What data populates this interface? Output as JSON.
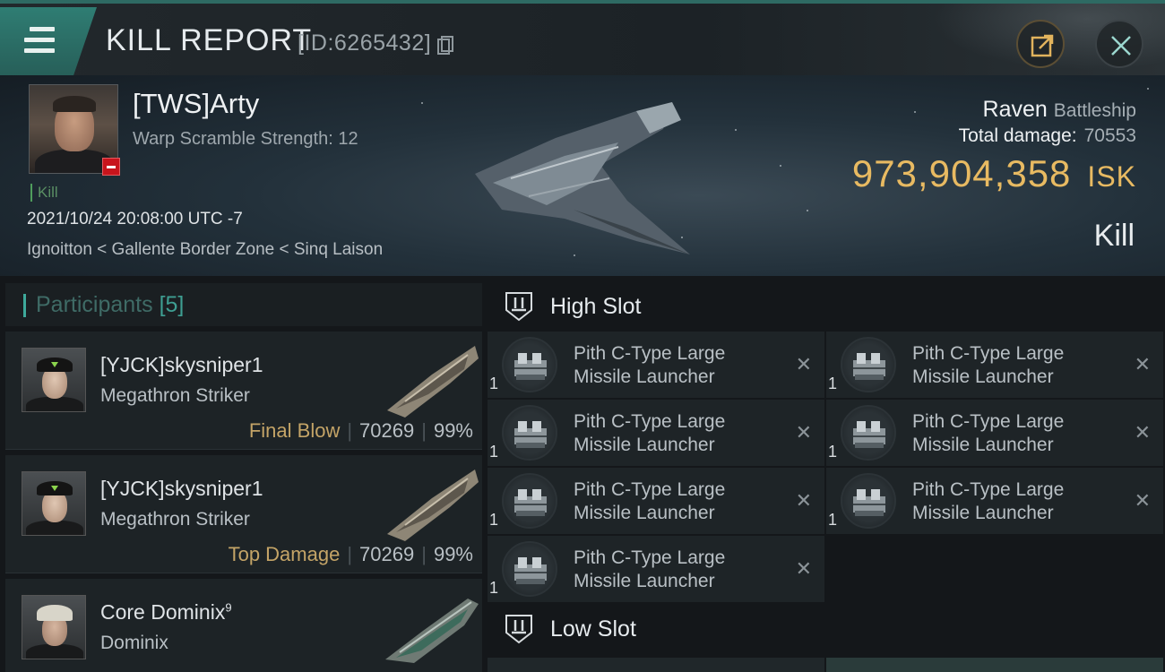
{
  "header": {
    "title": "KILL REPORT",
    "report_id": "[ID:6265432]"
  },
  "victim": {
    "name": "[TWS]Arty",
    "warp_scramble": "Warp Scramble Strength: 12",
    "kill_tag": "Kill",
    "datetime": "2021/10/24 20:08:00 UTC -7",
    "location": "Ignoitton < Gallente Border Zone < Sinq Laison",
    "ship_name": "Raven",
    "ship_class": "Battleship",
    "total_damage_label": "Total damage:",
    "total_damage": "70553",
    "isk_value": "973,904,358",
    "isk_unit": "ISK",
    "result": "Kill"
  },
  "participants": {
    "label": "Participants",
    "count": "[5]",
    "items": [
      {
        "name": "[YJCK]skysniper1",
        "sup": "",
        "ship": "Megathron Striker",
        "tag": "Final Blow",
        "damage": "70269",
        "percent": "99%"
      },
      {
        "name": "[YJCK]skysniper1",
        "sup": "",
        "ship": "Megathron Striker",
        "tag": "Top Damage",
        "damage": "70269",
        "percent": "99%"
      },
      {
        "name": "Core Dominix",
        "sup": "9",
        "ship": "Dominix",
        "tag": "",
        "damage": "",
        "percent": ""
      }
    ]
  },
  "fitting": {
    "high_slot_title": "High Slot",
    "low_slot_title": "Low Slot",
    "high_modules": [
      {
        "line1": "Pith C-Type Large",
        "line2": "Missile Launcher",
        "qty": "1"
      },
      {
        "line1": "Pith C-Type Large",
        "line2": "Missile Launcher",
        "qty": "1"
      },
      {
        "line1": "Pith C-Type Large",
        "line2": "Missile Launcher",
        "qty": "1"
      },
      {
        "line1": "Pith C-Type Large",
        "line2": "Missile Launcher",
        "qty": "1"
      },
      {
        "line1": "Pith C-Type Large",
        "line2": "Missile Launcher",
        "qty": "1"
      },
      {
        "line1": "Pith C-Type Large",
        "line2": "Missile Launcher",
        "qty": "1"
      },
      {
        "line1": "Pith C-Type Large",
        "line2": "Missile Launcher",
        "qty": "1"
      }
    ],
    "remove_symbol": "✕"
  },
  "colors": {
    "accent": "#2f7d73",
    "isk": "#e8ba62",
    "tag_gold": "#c4a467"
  },
  "icons": {
    "menu": "menu-icon",
    "copy": "copy-icon",
    "share": "share-icon",
    "close": "close-icon",
    "slot": "slot-icon",
    "module": "missile-launcher-icon"
  }
}
